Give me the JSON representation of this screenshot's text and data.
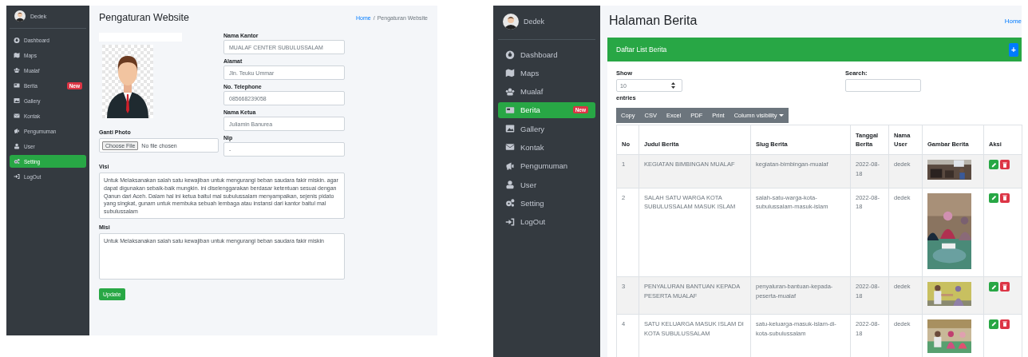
{
  "left_screen": {
    "sidebar": {
      "user": "Dedek",
      "items": [
        {
          "label": "Dashboard",
          "selected": false
        },
        {
          "label": "Maps",
          "selected": false
        },
        {
          "label": "Mualaf",
          "selected": false
        },
        {
          "label": "Berita",
          "selected": false,
          "badge": "New"
        },
        {
          "label": "Gallery",
          "selected": false
        },
        {
          "label": "Kontak",
          "selected": false
        },
        {
          "label": "Pengumuman",
          "selected": false
        },
        {
          "label": "User",
          "selected": false
        },
        {
          "label": "Setting",
          "selected": true
        },
        {
          "label": "LogOut",
          "selected": false
        }
      ]
    },
    "title": "Pengaturan Website",
    "breadcrumb": {
      "items": [
        "Home",
        "Pengaturan Website"
      ],
      "separator": "/"
    },
    "photo": {
      "label": "Ganti Photo",
      "button": "Choose File",
      "status": "No file chosen"
    },
    "fields": [
      {
        "label": "Nama Kantor",
        "value": "MUALAF CENTER SUBULUSSALAM"
      },
      {
        "label": "Alamat",
        "value": "Jln. Teuku Ummar"
      },
      {
        "label": "No. Telephone",
        "value": "085668239058"
      },
      {
        "label": "Nama Ketua",
        "value": "Juliamin  Banurea"
      },
      {
        "label": "Nip",
        "value": "-"
      }
    ],
    "textareas": [
      {
        "label": "Visi",
        "value": "Untuk Melaksanakan salah satu kewajiban untuk mengurangi beban saudara fakir miskin. agar dapat digunakan sebaik-baik mungkin. ini diselenggarakan berdasar ketentuan sesuai dengan Qanun dari Aceh. Dalam hal ini ketua baitul mal subulussalam menyampaikan, sejenis pidato yang singkat, gunam untuk membuka sebuah lembaga atau instansi dari kantor baitul mal subulussalam"
      },
      {
        "label": "Misi",
        "value": "Untuk Melaksanakan salah satu kewajiban untuk mengurangi beban saudara fakir miskin"
      }
    ],
    "submit": "Update"
  },
  "right_screen": {
    "sidebar": {
      "user": "Dedek",
      "items": [
        {
          "label": "Dashboard",
          "selected": false
        },
        {
          "label": "Maps",
          "selected": false
        },
        {
          "label": "Mualaf",
          "selected": false
        },
        {
          "label": "Berita",
          "selected": true,
          "badge": "New"
        },
        {
          "label": "Gallery",
          "selected": false
        },
        {
          "label": "Kontak",
          "selected": false
        },
        {
          "label": "Pengumuman",
          "selected": false
        },
        {
          "label": "User",
          "selected": false
        },
        {
          "label": "Setting",
          "selected": false
        },
        {
          "label": "LogOut",
          "selected": false
        }
      ]
    },
    "title": "Halaman Berita",
    "breadcrumb": "Home",
    "card_title": "Daftar List Berita",
    "add_button": "+",
    "length": {
      "label": "Show",
      "value": "10",
      "suffix": "entries"
    },
    "search_label": "Search:",
    "export_buttons": [
      "Copy",
      "CSV",
      "Excel",
      "PDF",
      "Print",
      "Column visibility"
    ],
    "table": {
      "columns": [
        "No",
        "Judul Berita",
        "Slug Berita",
        "Tanggal Berita",
        "Nama User",
        "Gambar Berita",
        "Aksi"
      ],
      "rows": [
        {
          "no": "1",
          "title": "KEGIATAN BIMBINGAN MUALAF",
          "slug": "kegiatan-bimbingan-mualaf",
          "date": "2022-08-18",
          "user": "dedek"
        },
        {
          "no": "2",
          "title": "SALAH SATU WARGA KOTA SUBULUSSALAM MASUK ISLAM",
          "slug": "salah-satu-warga-kota-subulussalam-masuk-islam",
          "date": "2022-08-18",
          "user": "dedek"
        },
        {
          "no": "3",
          "title": "PENYALURAN BANTUAN KEPADA PESERTA MUALAF",
          "slug": "penyaluran-bantuan-kepada-peserta-mualaf",
          "date": "2022-08-18",
          "user": "dedek"
        },
        {
          "no": "4",
          "title": "SATU KELUARGA MASUK ISLAM DI KOTA SUBULUSSALAM",
          "slug": "satu-keluarga-masuk-islam-di-kota-subulussalam",
          "date": "2022-08-18",
          "user": "dedek"
        }
      ]
    }
  }
}
